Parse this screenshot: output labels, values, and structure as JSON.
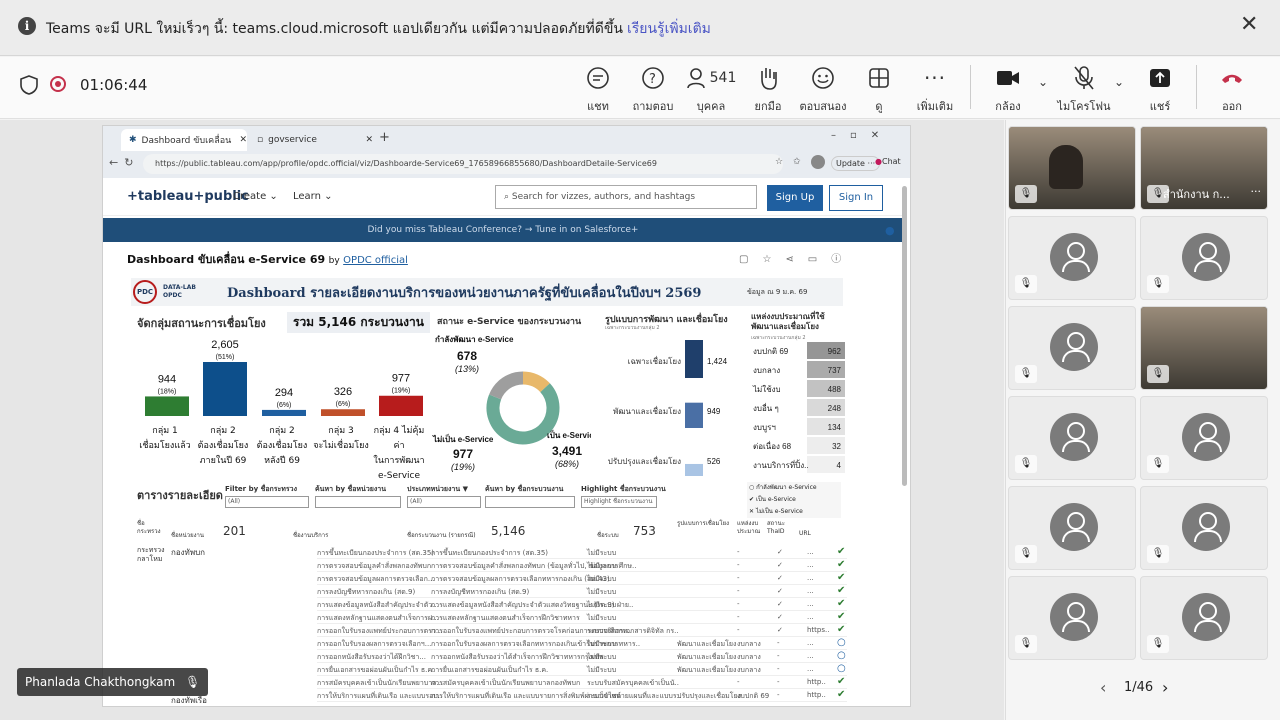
{
  "banner": {
    "message": "Teams จะมี URL ใหม่เร็วๆ นี้: teams.cloud.microsoft แอปเดียวกัน แต่มีความปลอดภัยที่ดีขึ้น",
    "link": "เรียนรู้เพิ่มเติม"
  },
  "meeting": {
    "timer": "01:06:44",
    "people_count": "541",
    "toolbar": [
      {
        "label": "แชท",
        "icon": "chat-icon"
      },
      {
        "label": "ถามตอบ",
        "icon": "qa-icon"
      },
      {
        "label": "บุคคล",
        "icon": "people-icon"
      },
      {
        "label": "ยกมือ",
        "icon": "raise-hand-icon"
      },
      {
        "label": "ตอบสนอง",
        "icon": "react-icon"
      },
      {
        "label": "ดู",
        "icon": "view-icon"
      },
      {
        "label": "เพิ่มเติม",
        "icon": "more-icon"
      },
      {
        "label": "กล้อง",
        "icon": "camera-icon"
      },
      {
        "label": "ไมโครโฟน",
        "icon": "mic-off-icon"
      },
      {
        "label": "แชร์",
        "icon": "share-icon"
      },
      {
        "label": "ออก",
        "icon": "leave-icon"
      }
    ],
    "presenter_name": "Phanlada Chakthongkam",
    "gallery_page": "1/46",
    "gallery_named_tile": "สำนักงาน ก...",
    "leave_color": "#c4314b"
  },
  "browser": {
    "tabs": [
      "Dashboard ขับเคลื่อน e-Service 69 |",
      "govservice"
    ],
    "url": "https://public.tableau.com/app/profile/opdc.official/viz/Dashboarde-Service69_17658966855680/DashboardDetaile-Service69",
    "update_label": "Update",
    "chat_label": "Chat"
  },
  "tableau": {
    "logo": "+tableau+public",
    "nav": [
      "Create",
      "Learn"
    ],
    "search_placeholder": "Search for vizzes, authors, and hashtags",
    "signup": "Sign Up",
    "signin": "Sign In",
    "banner": "Did you miss Tableau Conference? → Tune in on Salesforce+",
    "viz_title": "Dashboard ขับเคลื่อน e-Service 69",
    "by": "by",
    "author": "OPDC official"
  },
  "dashboard": {
    "logo_text": "DATA-LAB OPDC",
    "logo_mark": "PDC",
    "heading": "Dashboard รายละเอียดงานบริการของหน่วยงานภาครัฐที่ขับเคลื่อนในปีงบฯ 2569",
    "data_as_of": "ข้อมูล ณ 9 ม.ค. 69",
    "group_title": "จัดกลุ่มสถานะการเชื่อมโยง",
    "total": "รวม 5,146 กระบวนงาน",
    "status_title": "สถานะ e-Service ของกระบวนงาน",
    "dev_title": "รูปแบบการพัฒนา และเชื่อมโยง",
    "dev_sub": "เฉพาะกระบวนงานกลุ่ม 2",
    "budget_title": "แหล่งงบประมาณที่ใช้พัฒนาและเชื่อมโยง",
    "budget_sub": "เฉพาะกระบวนงานกลุ่ม 2",
    "table_title": "ตารางรายละเอียด",
    "filters": [
      {
        "label": "Filter by ชื่อกระทรวง",
        "value": "(All)"
      },
      {
        "label": "ค้นหา by ชื่อหน่วยงาน",
        "value": ""
      },
      {
        "label": "ประเภทหน่วยงาน ▼",
        "value": "(All)"
      },
      {
        "label": "ค้นหา by ชื่อกระบวนงาน",
        "value": ""
      },
      {
        "label": "Highlight ชื่อกระบวนงาน",
        "value": "Highlight ชื่อกระบวนงาน"
      }
    ],
    "legend": [
      "กำลังพัฒนา e-Service",
      "เป็น e-Service",
      "ไม่เป็น e-Service"
    ],
    "counts": {
      "agencies": "201",
      "processes": "5,146",
      "systems": "753"
    },
    "table_headers": [
      "ชื่อกระทรวง",
      "ชื่อหน่วยงาน",
      "ชื่องานบริการ",
      "ชื่อกระบวนงาน (รายกรณี)",
      "ชื่อระบบ",
      "รูปแบบการเชื่อมโยง",
      "แหล่งงบประมาณ",
      "สถานะ ThaID",
      "URL"
    ],
    "ministry": "กระทรวงกลาโหม",
    "agency": "กองทัพบก",
    "agency2": "กองทัพเรือ",
    "rows": [
      [
        "การขึ้นทะเบียนกองประจำการ (สด.35)",
        "การขึ้นทะเบียนกองประจำการ (สด.35)",
        "ไม่มีระบบ",
        "",
        "-",
        "✓",
        "..."
      ],
      [
        "การตรวจสอบข้อมูลคำสั่งพลกองทัพบก",
        "การตรวจสอบข้อมูลคำสั่งพลกองทัพบก (ข้อมูลทั่วไป, ข้อมูลการศึกษ..",
        "ไม่มีระบบ",
        "",
        "-",
        "✓",
        "..."
      ],
      [
        "การตรวจสอบข้อมูลผลการตรวจเลือก...",
        "การตรวจสอบข้อมูลผลการตรวจเลือกทหารกองเกิน (สด.43)",
        "ไม่มีระบบ",
        "",
        "-",
        "✓",
        "..."
      ],
      [
        "การลงบัญชีทหารกองเกิน (สด.9)",
        "การลงบัญชีทหารกองเกิน (สด.9)",
        "ไม่มีระบบ",
        "",
        "-",
        "✓",
        "..."
      ],
      [
        "การแสดงข้อมูลหนังสือสำคัญประจำตัว...",
        "การแสดงข้อมูลหนังสือสำคัญประจำตัวแสดงวิทยฐานะ (รด.3) ฝ่าย..",
        "ไม่มีระบบ",
        "",
        "-",
        "✓",
        "..."
      ],
      [
        "การแสดงหลักฐานแสดงตนสำเร็จการฝ...",
        "การแสดงหลักฐานแสดงตนสำเร็จการฝึกวิชาทหาร",
        "ไม่มีระบบ",
        "",
        "-",
        "✓",
        "..."
      ],
      [
        "การออกใบรับรองแพทย์ประกอบการตรว...",
        "การออกใบรับรองแพทย์ประกอบการตรวจโรคก่อนการตรวจเลือกท..",
        "ระบบบริการเอกสารดิจิทัล กร..",
        "",
        "-",
        "✓",
        "https.."
      ],
      [
        "การออกใบรับรองผลการตรวจเลือกฯ...",
        "การออกใบรับรองผลการตรวจเลือกทหารกองเกินเข้ารับราชการทหาร..",
        "ไม่มีระบบ",
        "พัฒนาและเชื่อมโยง",
        "งบกลาง",
        "-",
        "..."
      ],
      [
        "การออกหนังสือรับรองว่าได้ฝึกวิชา...",
        "การออกหนังสือรับรองว่าได้สำเร็จการฝึกวิชาทหารกรุงเทพ",
        "ไม่มีระบบ",
        "พัฒนาและเชื่อมโยง",
        "งบกลาง",
        "-",
        "..."
      ],
      [
        "การยื่นเอกสารขอผ่อนผันเป็นกำไร ธ.ค.",
        "การยื่นเอกสารขอผ่อนผันเป็นกำไร ธ.ค.",
        "ไม่มีระบบ",
        "พัฒนาและเชื่อมโยง",
        "งบกลาง",
        "-",
        "..."
      ],
      [
        "การสมัครบุคคลเข้าเป็นนักเรียนพยาบาล...",
        "การสมัครบุคคลเข้าเป็นนักเรียนพยาบาลกองทัพบก",
        "ระบบรับสมัครบุคคลเข้าเป็นนั..",
        "",
        "-",
        "-",
        "http.."
      ],
      [
        "การให้บริการแผนที่เดินเรือ และแบบรอบ..",
        "การให้บริการแผนที่เดินเรือ และแบบรายการสิ่งพิมพ์ผ่านเว็บไซต์",
        "ระบบจำหน่ายแผนที่และแบบร..",
        "ปรับปรุงและเชื่อมโยง",
        "งบปกติ 69",
        "-",
        "http.."
      ]
    ],
    "row_status": [
      "check",
      "check",
      "check",
      "check",
      "check",
      "check",
      "check",
      "circle",
      "circle",
      "circle",
      "check",
      "check"
    ]
  },
  "chart_data": [
    {
      "type": "bar",
      "title": "จัดกลุ่มสถานะการเชื่อมโยง",
      "categories": [
        "กลุ่ม 1 เชื่อมโยงแล้ว",
        "กลุ่ม 2 ต้องเชื่อมโยงภายในปี 69",
        "กลุ่ม 2 ต้องเชื่อมโยงหลังปี 69",
        "กลุ่ม 3 จะไม่เชื่อมโยง",
        "กลุ่ม 4 ไม่คุ้มค่าในการพัฒนา e-Service"
      ],
      "values": [
        944,
        2605,
        294,
        326,
        977
      ],
      "value_labels": [
        "944",
        "2,605",
        "294",
        "326",
        "977"
      ],
      "pct_labels": [
        "(18%)",
        "(51%)",
        "(6%)",
        "(6%)",
        "(19%)"
      ],
      "colors": [
        "#2e7d32",
        "#0d4f8b",
        "#1f5fa0",
        "#c0502a",
        "#b71c1c"
      ]
    },
    {
      "type": "pie",
      "title": "สถานะ e-Service ของกระบวนงาน",
      "categories": [
        "กำลังพัฒนา e-Service",
        "เป็น e-Service",
        "ไม่เป็น e-Service"
      ],
      "values": [
        678,
        3491,
        977
      ],
      "value_labels": [
        "678",
        "3,491",
        "977"
      ],
      "pct_labels": [
        "(13%)",
        "(68%)",
        "(19%)"
      ],
      "colors": [
        "#e8b86a",
        "#6aaa96",
        "#9e9e9e"
      ]
    },
    {
      "type": "bar",
      "title": "รูปแบบการพัฒนา และเชื่อมโยง",
      "categories": [
        "เฉพาะเชื่อมโยง",
        "พัฒนาและเชื่อมโยง",
        "ปรับปรุงและเชื่อมโยง"
      ],
      "values": [
        1424,
        949,
        526
      ],
      "value_labels": [
        "1,424",
        "949",
        "526"
      ],
      "colors": [
        "#1f3f6b",
        "#4a6fa5",
        "#a9c4e4"
      ]
    },
    {
      "type": "table",
      "title": "แหล่งงบประมาณที่ใช้พัฒนาและเชื่อมโยง",
      "categories": [
        "งบปกติ 69",
        "งบกลาง",
        "ไม่ใช้งบ",
        "งบอื่น ๆ",
        "งบบูรฯ",
        "ต่อเนื่อง 68",
        "งานบริการที่ปิ้ง.."
      ],
      "values": [
        962,
        737,
        488,
        248,
        134,
        32,
        4
      ]
    }
  ]
}
